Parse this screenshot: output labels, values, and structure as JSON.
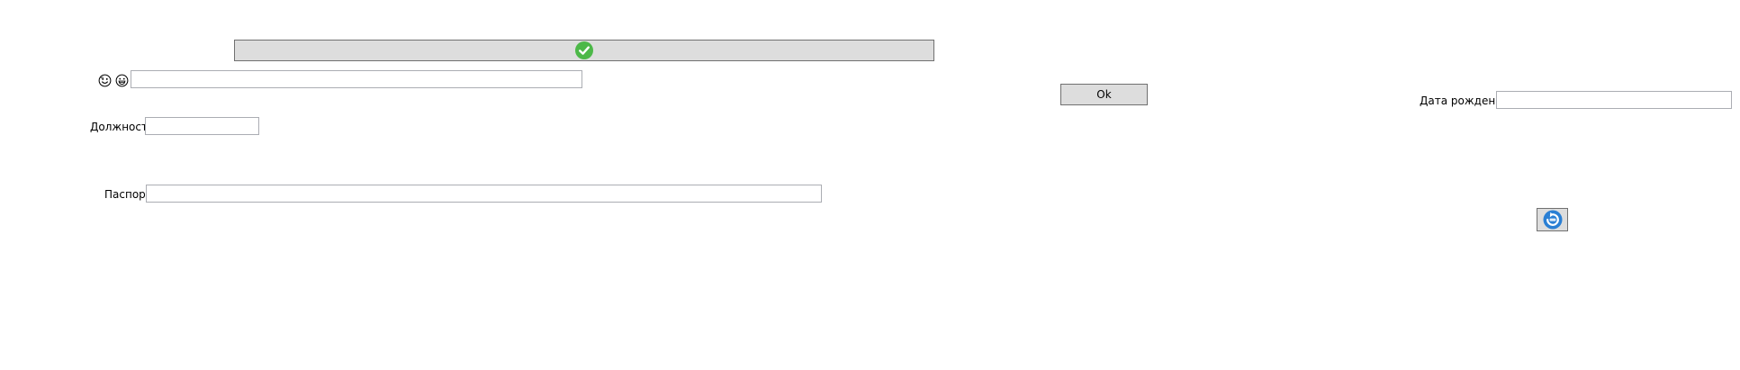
{
  "toolbar": {
    "confirm_icon": "check-circle-icon",
    "accent_color": "#4cb848"
  },
  "emoji_icons": [
    "smiley-face-icon",
    "grinning-face-icon"
  ],
  "name_field": {
    "value": ""
  },
  "ok_button": {
    "label": "Ok"
  },
  "birth_date": {
    "label": "Дата рождения",
    "value": ""
  },
  "position": {
    "label": "Должность",
    "value": ""
  },
  "passport": {
    "label": "Паспорт",
    "value": ""
  },
  "refresh_button": {
    "icon": "refresh-icon",
    "color": "#2a7fd4"
  }
}
